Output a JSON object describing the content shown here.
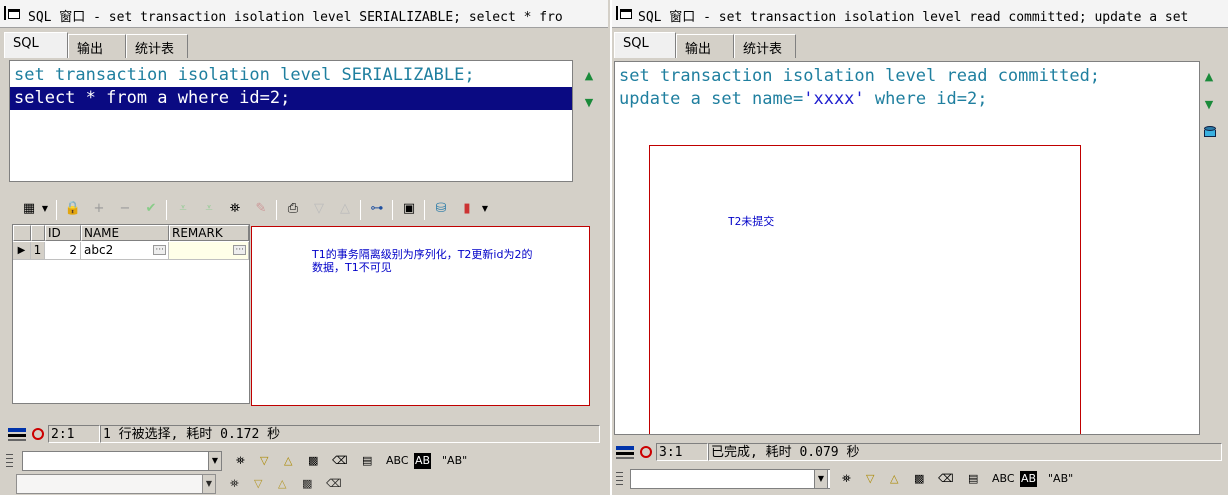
{
  "left": {
    "title": "SQL 窗口 - set transaction isolation level SERIALIZABLE; select * fro",
    "tabs": [
      "SQL",
      "输出",
      "统计表"
    ],
    "editor_lines": [
      "set transaction isolation level SERIALIZABLE;",
      "select * from a where id=2;"
    ],
    "grid": {
      "columns": [
        "ID",
        "NAME",
        "REMARK"
      ],
      "rows": [
        {
          "num": "1",
          "id": "2",
          "name": "abc2",
          "remark": ""
        }
      ]
    },
    "note": [
      "T1的事务隔离级别为序列化，T2更新id为2的",
      "数据，T1不可见"
    ],
    "status": {
      "pos": "2:1",
      "message": "1 行被选择, 耗时 0.172 秒"
    },
    "find_labels": [
      "ABC",
      "AB",
      "\"AB\""
    ]
  },
  "right": {
    "title": "SQL 窗口 - set transaction isolation level read committed; update a set",
    "tabs": [
      "SQL",
      "输出",
      "统计表"
    ],
    "editor_line1": "set transaction isolation level read committed;",
    "editor_line2": {
      "a": "update a set name=",
      "b": "'xxxx'",
      "c": " where id=2;"
    },
    "note": "T2未提交",
    "status": {
      "pos": "3:1",
      "message": "已完成, 耗时 0.079 秒"
    },
    "find_labels": [
      "ABC",
      "AB",
      "\"AB\""
    ]
  },
  "colors": {
    "keyword": "#1f7f9f",
    "string": "#1f1fcf",
    "selection": "#0a0a82",
    "note_border": "#c00000",
    "note_text": "#0000c8"
  }
}
